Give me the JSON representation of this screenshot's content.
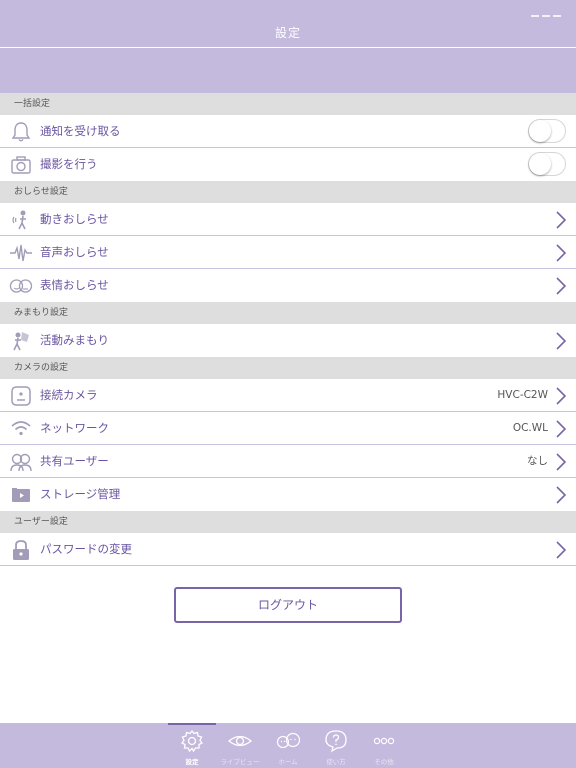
{
  "header": {
    "title": "設定"
  },
  "sections": {
    "bulk": {
      "title": "一括設定",
      "notify_label": "通知を受け取る",
      "shoot_label": "撮影を行う",
      "notify_on": false,
      "shoot_on": false
    },
    "alerts": {
      "title": "おしらせ設定",
      "motion_label": "動きおしらせ",
      "sound_label": "音声おしらせ",
      "face_label": "表情おしらせ"
    },
    "watch": {
      "title": "みまもり設定",
      "activity_label": "活動みまもり"
    },
    "camera": {
      "title": "カメラの設定",
      "connected_label": "接続カメラ",
      "connected_value": "HVC-C2W",
      "network_label": "ネットワーク",
      "network_value": "OC.WL",
      "shared_label": "共有ユーザー",
      "shared_value": "なし",
      "storage_label": "ストレージ管理"
    },
    "user": {
      "title": "ユーザー設定",
      "password_label": "パスワードの変更"
    }
  },
  "logout": {
    "label": "ログアウト"
  },
  "tabs": {
    "settings": "設定",
    "liveview": "ライブビュー",
    "home": "ホーム",
    "howto": "使い方",
    "other": "その他"
  },
  "colors": {
    "accent": "#7a64a8",
    "label": "#6a55a1",
    "bar": "#c4bade",
    "section": "#dedede"
  },
  "icons": {
    "notify": "bell-icon",
    "shoot": "camera-icon",
    "motion": "motion-person-icon",
    "sound": "waveform-icon",
    "face": "faces-icon",
    "activity": "activity-person-icon",
    "connected": "camera-device-icon",
    "network": "wifi-icon",
    "shared": "users-icon",
    "storage": "storage-icon",
    "password": "lock-icon",
    "chevron": "chevron-right-icon",
    "tab_settings": "gear-icon",
    "tab_liveview": "eye-icon",
    "tab_home": "family-icon",
    "tab_howto": "question-icon",
    "tab_other": "more-icon"
  }
}
